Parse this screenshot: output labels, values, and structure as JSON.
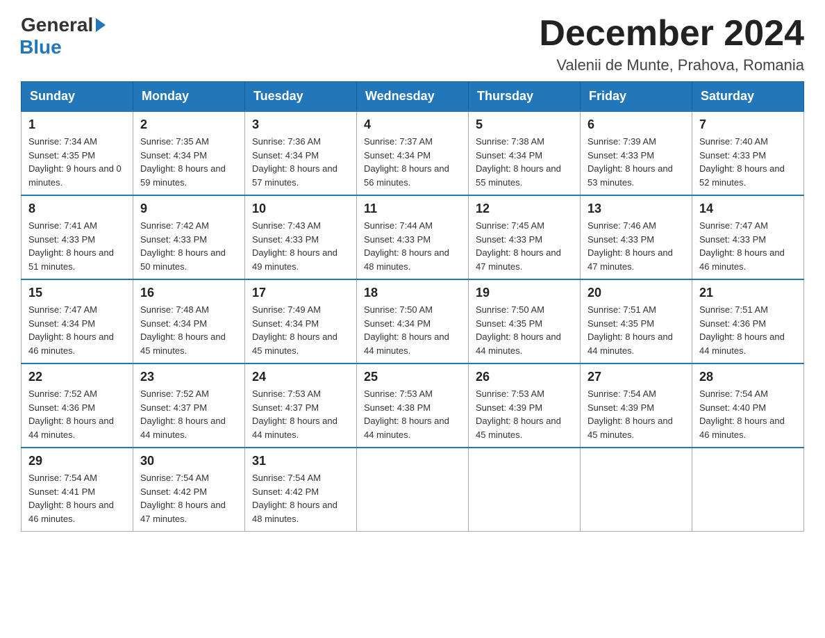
{
  "header": {
    "title": "December 2024",
    "subtitle": "Valenii de Munte, Prahova, Romania",
    "logo_general": "General",
    "logo_blue": "Blue"
  },
  "days_of_week": [
    "Sunday",
    "Monday",
    "Tuesday",
    "Wednesday",
    "Thursday",
    "Friday",
    "Saturday"
  ],
  "weeks": [
    [
      {
        "day": 1,
        "sunrise": "7:34 AM",
        "sunset": "4:35 PM",
        "daylight": "9 hours and 0 minutes."
      },
      {
        "day": 2,
        "sunrise": "7:35 AM",
        "sunset": "4:34 PM",
        "daylight": "8 hours and 59 minutes."
      },
      {
        "day": 3,
        "sunrise": "7:36 AM",
        "sunset": "4:34 PM",
        "daylight": "8 hours and 57 minutes."
      },
      {
        "day": 4,
        "sunrise": "7:37 AM",
        "sunset": "4:34 PM",
        "daylight": "8 hours and 56 minutes."
      },
      {
        "day": 5,
        "sunrise": "7:38 AM",
        "sunset": "4:34 PM",
        "daylight": "8 hours and 55 minutes."
      },
      {
        "day": 6,
        "sunrise": "7:39 AM",
        "sunset": "4:33 PM",
        "daylight": "8 hours and 53 minutes."
      },
      {
        "day": 7,
        "sunrise": "7:40 AM",
        "sunset": "4:33 PM",
        "daylight": "8 hours and 52 minutes."
      }
    ],
    [
      {
        "day": 8,
        "sunrise": "7:41 AM",
        "sunset": "4:33 PM",
        "daylight": "8 hours and 51 minutes."
      },
      {
        "day": 9,
        "sunrise": "7:42 AM",
        "sunset": "4:33 PM",
        "daylight": "8 hours and 50 minutes."
      },
      {
        "day": 10,
        "sunrise": "7:43 AM",
        "sunset": "4:33 PM",
        "daylight": "8 hours and 49 minutes."
      },
      {
        "day": 11,
        "sunrise": "7:44 AM",
        "sunset": "4:33 PM",
        "daylight": "8 hours and 48 minutes."
      },
      {
        "day": 12,
        "sunrise": "7:45 AM",
        "sunset": "4:33 PM",
        "daylight": "8 hours and 47 minutes."
      },
      {
        "day": 13,
        "sunrise": "7:46 AM",
        "sunset": "4:33 PM",
        "daylight": "8 hours and 47 minutes."
      },
      {
        "day": 14,
        "sunrise": "7:47 AM",
        "sunset": "4:33 PM",
        "daylight": "8 hours and 46 minutes."
      }
    ],
    [
      {
        "day": 15,
        "sunrise": "7:47 AM",
        "sunset": "4:34 PM",
        "daylight": "8 hours and 46 minutes."
      },
      {
        "day": 16,
        "sunrise": "7:48 AM",
        "sunset": "4:34 PM",
        "daylight": "8 hours and 45 minutes."
      },
      {
        "day": 17,
        "sunrise": "7:49 AM",
        "sunset": "4:34 PM",
        "daylight": "8 hours and 45 minutes."
      },
      {
        "day": 18,
        "sunrise": "7:50 AM",
        "sunset": "4:34 PM",
        "daylight": "8 hours and 44 minutes."
      },
      {
        "day": 19,
        "sunrise": "7:50 AM",
        "sunset": "4:35 PM",
        "daylight": "8 hours and 44 minutes."
      },
      {
        "day": 20,
        "sunrise": "7:51 AM",
        "sunset": "4:35 PM",
        "daylight": "8 hours and 44 minutes."
      },
      {
        "day": 21,
        "sunrise": "7:51 AM",
        "sunset": "4:36 PM",
        "daylight": "8 hours and 44 minutes."
      }
    ],
    [
      {
        "day": 22,
        "sunrise": "7:52 AM",
        "sunset": "4:36 PM",
        "daylight": "8 hours and 44 minutes."
      },
      {
        "day": 23,
        "sunrise": "7:52 AM",
        "sunset": "4:37 PM",
        "daylight": "8 hours and 44 minutes."
      },
      {
        "day": 24,
        "sunrise": "7:53 AM",
        "sunset": "4:37 PM",
        "daylight": "8 hours and 44 minutes."
      },
      {
        "day": 25,
        "sunrise": "7:53 AM",
        "sunset": "4:38 PM",
        "daylight": "8 hours and 44 minutes."
      },
      {
        "day": 26,
        "sunrise": "7:53 AM",
        "sunset": "4:39 PM",
        "daylight": "8 hours and 45 minutes."
      },
      {
        "day": 27,
        "sunrise": "7:54 AM",
        "sunset": "4:39 PM",
        "daylight": "8 hours and 45 minutes."
      },
      {
        "day": 28,
        "sunrise": "7:54 AM",
        "sunset": "4:40 PM",
        "daylight": "8 hours and 46 minutes."
      }
    ],
    [
      {
        "day": 29,
        "sunrise": "7:54 AM",
        "sunset": "4:41 PM",
        "daylight": "8 hours and 46 minutes."
      },
      {
        "day": 30,
        "sunrise": "7:54 AM",
        "sunset": "4:42 PM",
        "daylight": "8 hours and 47 minutes."
      },
      {
        "day": 31,
        "sunrise": "7:54 AM",
        "sunset": "4:42 PM",
        "daylight": "8 hours and 48 minutes."
      },
      null,
      null,
      null,
      null
    ]
  ]
}
